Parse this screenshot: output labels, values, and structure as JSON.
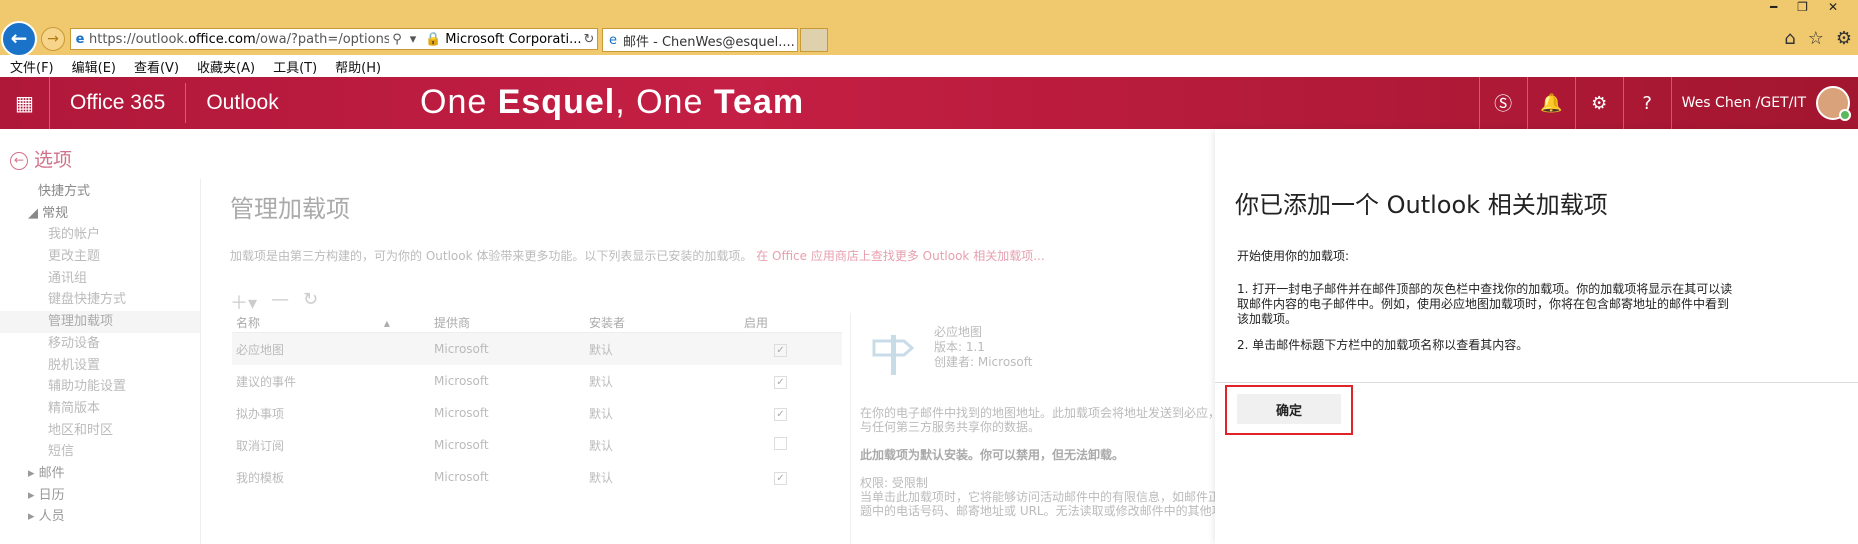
{
  "browser": {
    "url_prefix": "https://outlook.",
    "url_domain": "office.com",
    "url_rest": "/owa/?path=/options/m",
    "cert": "Microsoft Corporati...",
    "tab_title": "邮件 - ChenWes@esquel....",
    "tab_close": "×",
    "win_min": "━",
    "win_max": "❐",
    "win_close": "✕"
  },
  "menubar": [
    "文件(F)",
    "编辑(E)",
    "查看(V)",
    "收藏夹(A)",
    "工具(T)",
    "帮助(H)"
  ],
  "suite": {
    "brand": "Office 365",
    "app": "Outlook",
    "slogan_a": "One ",
    "slogan_b": "Esquel",
    "slogan_c": ", One ",
    "slogan_d": "Team",
    "user": "Wes Chen /GET/IT",
    "watermark": "One Esquel,"
  },
  "options": {
    "title": "选项",
    "nav": {
      "shortcuts": "快捷方式",
      "general": "常规",
      "general_items": [
        "我的帐户",
        "更改主题",
        "通讯组",
        "键盘快捷方式",
        "管理加载项",
        "移动设备",
        "脱机设置",
        "辅助功能设置",
        "精简版本",
        "地区和时区",
        "短信"
      ],
      "mail": "邮件",
      "calendar": "日历",
      "people": "人员"
    }
  },
  "main": {
    "title": "管理加载项",
    "desc": "加载项是由第三方构建的，可为你的 Outlook 体验带来更多功能。以下列表显示已安装的加载项。",
    "store_link": "在 Office 应用商店上查找更多 Outlook 相关加载项...",
    "columns": [
      "名称",
      "提供商",
      "安装者",
      "启用"
    ],
    "rows": [
      {
        "name": "必应地图",
        "provider": "Microsoft",
        "installer": "默认",
        "enabled": "✓"
      },
      {
        "name": "建议的事件",
        "provider": "Microsoft",
        "installer": "默认",
        "enabled": "✓"
      },
      {
        "name": "拟办事项",
        "provider": "Microsoft",
        "installer": "默认",
        "enabled": "✓"
      },
      {
        "name": "取消订阅",
        "provider": "Microsoft",
        "installer": "默认",
        "enabled": ""
      },
      {
        "name": "我的模板",
        "provider": "Microsoft",
        "installer": "默认",
        "enabled": "✓"
      }
    ],
    "detail": {
      "name": "必应地图",
      "version": "版本: 1.1",
      "creator": "创建者: Microsoft",
      "desc1": "在你的电子邮件中找到的地图地址。此加载项会将地址发送到必应，",
      "desc2": "与任何第三方服务共享你的数据。",
      "default_note": "此加载项为默认安装。你可以禁用，但无法卸载。",
      "perm": "权限: 受限制",
      "perm_desc1": "当单击此加载项时，它将能够访问活动邮件中的有限信息，如邮件正",
      "perm_desc2": "题中的电话号码、邮寄地址或 URL。无法读取或修改邮件中的其他项"
    }
  },
  "dialog": {
    "title": "你已添加一个 Outlook 相关加载项",
    "intro": "开始使用你的加载项:",
    "step1_a": "1. 打开一封电子邮件并在邮件顶部的灰色栏中查找你的加载项。你的加载项将显示在其可以读",
    "step1_b": "取邮件内容的电子邮件中。例如，使用必应地图加载项时，你将在包含邮寄地址的邮件中看到",
    "step1_c": "该加载项。",
    "step2": "2. 单击邮件标题下方栏中的加载项名称以查看其内容。",
    "ok": "确定"
  },
  "colors": {
    "suite_red": "#c41f44",
    "highlight": "#e0232b",
    "chrome": "#f0c86e"
  }
}
